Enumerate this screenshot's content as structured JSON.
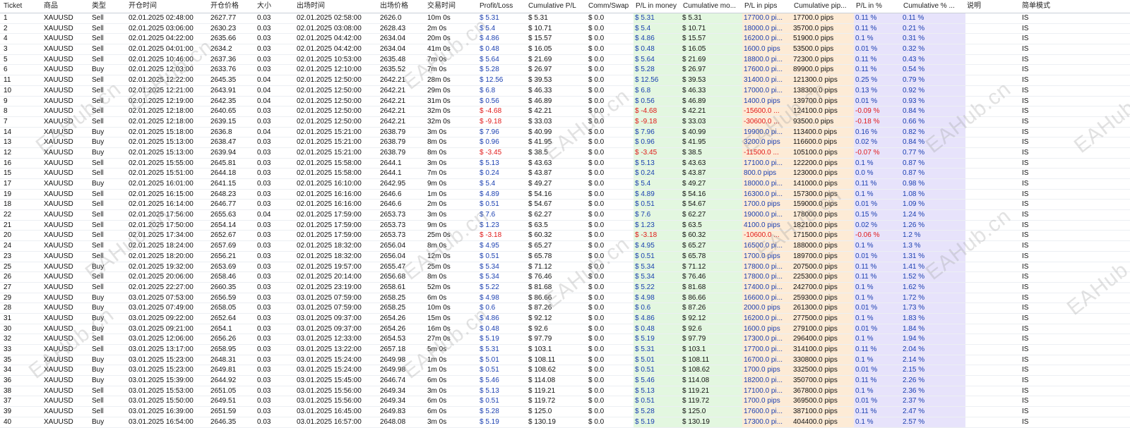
{
  "columns": [
    "Ticket",
    "商品",
    "类型",
    "开仓时间",
    "开仓价格",
    "大小",
    "出场时间",
    "出场价格",
    "交易时间",
    "Profit/Loss",
    "Cumulative P/L",
    "Comm/Swap",
    "P/L in money",
    "Cumulative mo...",
    "P/L in pips",
    "Cumulative pip...",
    "P/L in %",
    "Cumulative % ...",
    "说明",
    "简单模式"
  ],
  "watermark": "EAHub.cn",
  "rows": [
    [
      "1",
      "XAUUSD",
      "Sell",
      "02.01.2025 02:48:00",
      "2627.77",
      "0.03",
      "02.01.2025 02:58:00",
      "2626.0",
      "10m 0s",
      "$ 5.31",
      "$ 5.31",
      "$ 0.0",
      "$ 5.31",
      "$ 5.31",
      "17700.0 pi...",
      "17700.0 pips",
      "0.11 %",
      "0.11 %",
      "",
      "IS"
    ],
    [
      "2",
      "XAUUSD",
      "Sell",
      "02.01.2025 03:06:00",
      "2630.23",
      "0.03",
      "02.01.2025 03:08:00",
      "2628.43",
      "2m 0s",
      "$ 5.4",
      "$ 10.71",
      "$ 0.0",
      "$ 5.4",
      "$ 10.71",
      "18000.0 pi...",
      "35700.0 pips",
      "0.11 %",
      "0.21 %",
      "",
      "IS"
    ],
    [
      "4",
      "XAUUSD",
      "Sell",
      "02.01.2025 04:22:00",
      "2635.66",
      "0.03",
      "02.01.2025 04:42:00",
      "2634.04",
      "20m 0s",
      "$ 4.86",
      "$ 15.57",
      "$ 0.0",
      "$ 4.86",
      "$ 15.57",
      "16200.0 pi...",
      "51900.0 pips",
      "0.1 %",
      "0.31 %",
      "",
      "IS"
    ],
    [
      "3",
      "XAUUSD",
      "Sell",
      "02.01.2025 04:01:00",
      "2634.2",
      "0.03",
      "02.01.2025 04:42:00",
      "2634.04",
      "41m 0s",
      "$ 0.48",
      "$ 16.05",
      "$ 0.0",
      "$ 0.48",
      "$ 16.05",
      "1600.0 pips",
      "53500.0 pips",
      "0.01 %",
      "0.32 %",
      "",
      "IS"
    ],
    [
      "5",
      "XAUUSD",
      "Sell",
      "02.01.2025 10:46:00",
      "2637.36",
      "0.03",
      "02.01.2025 10:53:00",
      "2635.48",
      "7m 0s",
      "$ 5.64",
      "$ 21.69",
      "$ 0.0",
      "$ 5.64",
      "$ 21.69",
      "18800.0 pi...",
      "72300.0 pips",
      "0.11 %",
      "0.43 %",
      "",
      "IS"
    ],
    [
      "6",
      "XAUUSD",
      "Buy",
      "02.01.2025 12:03:00",
      "2633.76",
      "0.03",
      "02.01.2025 12:10:00",
      "2635.52",
      "7m 0s",
      "$ 5.28",
      "$ 26.97",
      "$ 0.0",
      "$ 5.28",
      "$ 26.97",
      "17600.0 pi...",
      "89900.0 pips",
      "0.11 %",
      "0.54 %",
      "",
      "IS"
    ],
    [
      "11",
      "XAUUSD",
      "Sell",
      "02.01.2025 12:22:00",
      "2645.35",
      "0.04",
      "02.01.2025 12:50:00",
      "2642.21",
      "28m 0s",
      "$ 12.56",
      "$ 39.53",
      "$ 0.0",
      "$ 12.56",
      "$ 39.53",
      "31400.0 pi...",
      "121300.0 pips",
      "0.25 %",
      "0.79 %",
      "",
      "IS"
    ],
    [
      "10",
      "XAUUSD",
      "Sell",
      "02.01.2025 12:21:00",
      "2643.91",
      "0.04",
      "02.01.2025 12:50:00",
      "2642.21",
      "29m 0s",
      "$ 6.8",
      "$ 46.33",
      "$ 0.0",
      "$ 6.8",
      "$ 46.33",
      "17000.0 pi...",
      "138300.0 pips",
      "0.13 %",
      "0.92 %",
      "",
      "IS"
    ],
    [
      "9",
      "XAUUSD",
      "Sell",
      "02.01.2025 12:19:00",
      "2642.35",
      "0.04",
      "02.01.2025 12:50:00",
      "2642.21",
      "31m 0s",
      "$ 0.56",
      "$ 46.89",
      "$ 0.0",
      "$ 0.56",
      "$ 46.89",
      "1400.0 pips",
      "139700.0 pips",
      "0.01 %",
      "0.93 %",
      "",
      "IS"
    ],
    [
      "8",
      "XAUUSD",
      "Sell",
      "02.01.2025 12:18:00",
      "2640.65",
      "0.03",
      "02.01.2025 12:50:00",
      "2642.21",
      "32m 0s",
      "$ -4.68",
      "$ 42.21",
      "$ 0.0",
      "$ -4.68",
      "$ 42.21",
      "-15600.0 ...",
      "124100.0 pips",
      "-0.09 %",
      "0.84 %",
      "",
      "IS"
    ],
    [
      "7",
      "XAUUSD",
      "Sell",
      "02.01.2025 12:18:00",
      "2639.15",
      "0.03",
      "02.01.2025 12:50:00",
      "2642.21",
      "32m 0s",
      "$ -9.18",
      "$ 33.03",
      "$ 0.0",
      "$ -9.18",
      "$ 33.03",
      "-30600.0 ...",
      "93500.0 pips",
      "-0.18 %",
      "0.66 %",
      "",
      "IS"
    ],
    [
      "14",
      "XAUUSD",
      "Buy",
      "02.01.2025 15:18:00",
      "2636.8",
      "0.04",
      "02.01.2025 15:21:00",
      "2638.79",
      "3m 0s",
      "$ 7.96",
      "$ 40.99",
      "$ 0.0",
      "$ 7.96",
      "$ 40.99",
      "19900.0 pi...",
      "113400.0 pips",
      "0.16 %",
      "0.82 %",
      "",
      "IS"
    ],
    [
      "13",
      "XAUUSD",
      "Buy",
      "02.01.2025 15:13:00",
      "2638.47",
      "0.03",
      "02.01.2025 15:21:00",
      "2638.79",
      "8m 0s",
      "$ 0.96",
      "$ 41.95",
      "$ 0.0",
      "$ 0.96",
      "$ 41.95",
      "3200.0 pips",
      "116600.0 pips",
      "0.02 %",
      "0.84 %",
      "",
      "IS"
    ],
    [
      "12",
      "XAUUSD",
      "Buy",
      "02.01.2025 15:13:00",
      "2639.94",
      "0.03",
      "02.01.2025 15:21:00",
      "2638.79",
      "8m 0s",
      "$ -3.45",
      "$ 38.5",
      "$ 0.0",
      "$ -3.45",
      "$ 38.5",
      "-11500.0 ...",
      "105100.0 pips",
      "-0.07 %",
      "0.77 %",
      "",
      "IS"
    ],
    [
      "16",
      "XAUUSD",
      "Sell",
      "02.01.2025 15:55:00",
      "2645.81",
      "0.03",
      "02.01.2025 15:58:00",
      "2644.1",
      "3m 0s",
      "$ 5.13",
      "$ 43.63",
      "$ 0.0",
      "$ 5.13",
      "$ 43.63",
      "17100.0 pi...",
      "122200.0 pips",
      "0.1 %",
      "0.87 %",
      "",
      "IS"
    ],
    [
      "15",
      "XAUUSD",
      "Sell",
      "02.01.2025 15:51:00",
      "2644.18",
      "0.03",
      "02.01.2025 15:58:00",
      "2644.1",
      "7m 0s",
      "$ 0.24",
      "$ 43.87",
      "$ 0.0",
      "$ 0.24",
      "$ 43.87",
      "800.0 pips",
      "123000.0 pips",
      "0.0 %",
      "0.87 %",
      "",
      "IS"
    ],
    [
      "17",
      "XAUUSD",
      "Buy",
      "02.01.2025 16:01:00",
      "2641.15",
      "0.03",
      "02.01.2025 16:10:00",
      "2642.95",
      "9m 0s",
      "$ 5.4",
      "$ 49.27",
      "$ 0.0",
      "$ 5.4",
      "$ 49.27",
      "18000.0 pi...",
      "141000.0 pips",
      "0.11 %",
      "0.98 %",
      "",
      "IS"
    ],
    [
      "19",
      "XAUUSD",
      "Sell",
      "02.01.2025 16:15:00",
      "2648.23",
      "0.03",
      "02.01.2025 16:16:00",
      "2646.6",
      "1m 0s",
      "$ 4.89",
      "$ 54.16",
      "$ 0.0",
      "$ 4.89",
      "$ 54.16",
      "16300.0 pi...",
      "157300.0 pips",
      "0.1 %",
      "1.08 %",
      "",
      "IS"
    ],
    [
      "18",
      "XAUUSD",
      "Sell",
      "02.01.2025 16:14:00",
      "2646.77",
      "0.03",
      "02.01.2025 16:16:00",
      "2646.6",
      "2m 0s",
      "$ 0.51",
      "$ 54.67",
      "$ 0.0",
      "$ 0.51",
      "$ 54.67",
      "1700.0 pips",
      "159000.0 pips",
      "0.01 %",
      "1.09 %",
      "",
      "IS"
    ],
    [
      "22",
      "XAUUSD",
      "Sell",
      "02.01.2025 17:56:00",
      "2655.63",
      "0.04",
      "02.01.2025 17:59:00",
      "2653.73",
      "3m 0s",
      "$ 7.6",
      "$ 62.27",
      "$ 0.0",
      "$ 7.6",
      "$ 62.27",
      "19000.0 pi...",
      "178000.0 pips",
      "0.15 %",
      "1.24 %",
      "",
      "IS"
    ],
    [
      "21",
      "XAUUSD",
      "Sell",
      "02.01.2025 17:50:00",
      "2654.14",
      "0.03",
      "02.01.2025 17:59:00",
      "2653.73",
      "9m 0s",
      "$ 1.23",
      "$ 63.5",
      "$ 0.0",
      "$ 1.23",
      "$ 63.5",
      "4100.0 pips",
      "182100.0 pips",
      "0.02 %",
      "1.26 %",
      "",
      "IS"
    ],
    [
      "20",
      "XAUUSD",
      "Sell",
      "02.01.2025 17:34:00",
      "2652.67",
      "0.03",
      "02.01.2025 17:59:00",
      "2653.73",
      "25m 0s",
      "$ -3.18",
      "$ 60.32",
      "$ 0.0",
      "$ -3.18",
      "$ 60.32",
      "-10600.0 ...",
      "171500.0 pips",
      "-0.06 %",
      "1.2 %",
      "",
      "IS"
    ],
    [
      "24",
      "XAUUSD",
      "Sell",
      "02.01.2025 18:24:00",
      "2657.69",
      "0.03",
      "02.01.2025 18:32:00",
      "2656.04",
      "8m 0s",
      "$ 4.95",
      "$ 65.27",
      "$ 0.0",
      "$ 4.95",
      "$ 65.27",
      "16500.0 pi...",
      "188000.0 pips",
      "0.1 %",
      "1.3 %",
      "",
      "IS"
    ],
    [
      "23",
      "XAUUSD",
      "Sell",
      "02.01.2025 18:20:00",
      "2656.21",
      "0.03",
      "02.01.2025 18:32:00",
      "2656.04",
      "12m 0s",
      "$ 0.51",
      "$ 65.78",
      "$ 0.0",
      "$ 0.51",
      "$ 65.78",
      "1700.0 pips",
      "189700.0 pips",
      "0.01 %",
      "1.31 %",
      "",
      "IS"
    ],
    [
      "25",
      "XAUUSD",
      "Buy",
      "02.01.2025 19:32:00",
      "2653.69",
      "0.03",
      "02.01.2025 19:57:00",
      "2655.47",
      "25m 0s",
      "$ 5.34",
      "$ 71.12",
      "$ 0.0",
      "$ 5.34",
      "$ 71.12",
      "17800.0 pi...",
      "207500.0 pips",
      "0.11 %",
      "1.41 %",
      "",
      "IS"
    ],
    [
      "26",
      "XAUUSD",
      "Sell",
      "02.01.2025 20:06:00",
      "2658.46",
      "0.03",
      "02.01.2025 20:14:00",
      "2656.68",
      "8m 0s",
      "$ 5.34",
      "$ 76.46",
      "$ 0.0",
      "$ 5.34",
      "$ 76.46",
      "17800.0 pi...",
      "225300.0 pips",
      "0.11 %",
      "1.52 %",
      "",
      "IS"
    ],
    [
      "27",
      "XAUUSD",
      "Sell",
      "02.01.2025 22:27:00",
      "2660.35",
      "0.03",
      "02.01.2025 23:19:00",
      "2658.61",
      "52m 0s",
      "$ 5.22",
      "$ 81.68",
      "$ 0.0",
      "$ 5.22",
      "$ 81.68",
      "17400.0 pi...",
      "242700.0 pips",
      "0.1 %",
      "1.62 %",
      "",
      "IS"
    ],
    [
      "29",
      "XAUUSD",
      "Buy",
      "03.01.2025 07:53:00",
      "2656.59",
      "0.03",
      "03.01.2025 07:59:00",
      "2658.25",
      "6m 0s",
      "$ 4.98",
      "$ 86.66",
      "$ 0.0",
      "$ 4.98",
      "$ 86.66",
      "16600.0 pi...",
      "259300.0 pips",
      "0.1 %",
      "1.72 %",
      "",
      "IS"
    ],
    [
      "28",
      "XAUUSD",
      "Buy",
      "03.01.2025 07:49:00",
      "2658.05",
      "0.03",
      "03.01.2025 07:59:00",
      "2658.25",
      "10m 0s",
      "$ 0.6",
      "$ 87.26",
      "$ 0.0",
      "$ 0.6",
      "$ 87.26",
      "2000.0 pips",
      "261300.0 pips",
      "0.01 %",
      "1.73 %",
      "",
      "IS"
    ],
    [
      "31",
      "XAUUSD",
      "Buy",
      "03.01.2025 09:22:00",
      "2652.64",
      "0.03",
      "03.01.2025 09:37:00",
      "2654.26",
      "15m 0s",
      "$ 4.86",
      "$ 92.12",
      "$ 0.0",
      "$ 4.86",
      "$ 92.12",
      "16200.0 pi...",
      "277500.0 pips",
      "0.1 %",
      "1.83 %",
      "",
      "IS"
    ],
    [
      "30",
      "XAUUSD",
      "Buy",
      "03.01.2025 09:21:00",
      "2654.1",
      "0.03",
      "03.01.2025 09:37:00",
      "2654.26",
      "16m 0s",
      "$ 0.48",
      "$ 92.6",
      "$ 0.0",
      "$ 0.48",
      "$ 92.6",
      "1600.0 pips",
      "279100.0 pips",
      "0.01 %",
      "1.84 %",
      "",
      "IS"
    ],
    [
      "32",
      "XAUUSD",
      "Sell",
      "03.01.2025 12:06:00",
      "2656.26",
      "0.03",
      "03.01.2025 12:33:00",
      "2654.53",
      "27m 0s",
      "$ 5.19",
      "$ 97.79",
      "$ 0.0",
      "$ 5.19",
      "$ 97.79",
      "17300.0 pi...",
      "296400.0 pips",
      "0.1 %",
      "1.94 %",
      "",
      "IS"
    ],
    [
      "33",
      "XAUUSD",
      "Sell",
      "03.01.2025 13:17:00",
      "2658.95",
      "0.03",
      "03.01.2025 13:22:00",
      "2657.18",
      "5m 0s",
      "$ 5.31",
      "$ 103.1",
      "$ 0.0",
      "$ 5.31",
      "$ 103.1",
      "17700.0 pi...",
      "314100.0 pips",
      "0.11 %",
      "2.04 %",
      "",
      "IS"
    ],
    [
      "35",
      "XAUUSD",
      "Buy",
      "03.01.2025 15:23:00",
      "2648.31",
      "0.03",
      "03.01.2025 15:24:00",
      "2649.98",
      "1m 0s",
      "$ 5.01",
      "$ 108.11",
      "$ 0.0",
      "$ 5.01",
      "$ 108.11",
      "16700.0 pi...",
      "330800.0 pips",
      "0.1 %",
      "2.14 %",
      "",
      "IS"
    ],
    [
      "34",
      "XAUUSD",
      "Buy",
      "03.01.2025 15:23:00",
      "2649.81",
      "0.03",
      "03.01.2025 15:24:00",
      "2649.98",
      "1m 0s",
      "$ 0.51",
      "$ 108.62",
      "$ 0.0",
      "$ 0.51",
      "$ 108.62",
      "1700.0 pips",
      "332500.0 pips",
      "0.01 %",
      "2.15 %",
      "",
      "IS"
    ],
    [
      "36",
      "XAUUSD",
      "Buy",
      "03.01.2025 15:39:00",
      "2644.92",
      "0.03",
      "03.01.2025 15:45:00",
      "2646.74",
      "6m 0s",
      "$ 5.46",
      "$ 114.08",
      "$ 0.0",
      "$ 5.46",
      "$ 114.08",
      "18200.0 pi...",
      "350700.0 pips",
      "0.11 %",
      "2.26 %",
      "",
      "IS"
    ],
    [
      "38",
      "XAUUSD",
      "Sell",
      "03.01.2025 15:53:00",
      "2651.05",
      "0.03",
      "03.01.2025 15:56:00",
      "2649.34",
      "3m 0s",
      "$ 5.13",
      "$ 119.21",
      "$ 0.0",
      "$ 5.13",
      "$ 119.21",
      "17100.0 pi...",
      "367800.0 pips",
      "0.1 %",
      "2.36 %",
      "",
      "IS"
    ],
    [
      "37",
      "XAUUSD",
      "Sell",
      "03.01.2025 15:50:00",
      "2649.51",
      "0.03",
      "03.01.2025 15:56:00",
      "2649.34",
      "6m 0s",
      "$ 0.51",
      "$ 119.72",
      "$ 0.0",
      "$ 0.51",
      "$ 119.72",
      "1700.0 pips",
      "369500.0 pips",
      "0.01 %",
      "2.37 %",
      "",
      "IS"
    ],
    [
      "39",
      "XAUUSD",
      "Sell",
      "03.01.2025 16:39:00",
      "2651.59",
      "0.03",
      "03.01.2025 16:45:00",
      "2649.83",
      "6m 0s",
      "$ 5.28",
      "$ 125.0",
      "$ 0.0",
      "$ 5.28",
      "$ 125.0",
      "17600.0 pi...",
      "387100.0 pips",
      "0.11 %",
      "2.47 %",
      "",
      "IS"
    ],
    [
      "40",
      "XAUUSD",
      "Buy",
      "03.01.2025 16:54:00",
      "2646.35",
      "0.03",
      "03.01.2025 16:57:00",
      "2648.08",
      "3m 0s",
      "$ 5.19",
      "$ 130.19",
      "$ 0.0",
      "$ 5.19",
      "$ 130.19",
      "17300.0 pi...",
      "404400.0 pips",
      "0.1 %",
      "2.57 %",
      "",
      "IS"
    ]
  ]
}
